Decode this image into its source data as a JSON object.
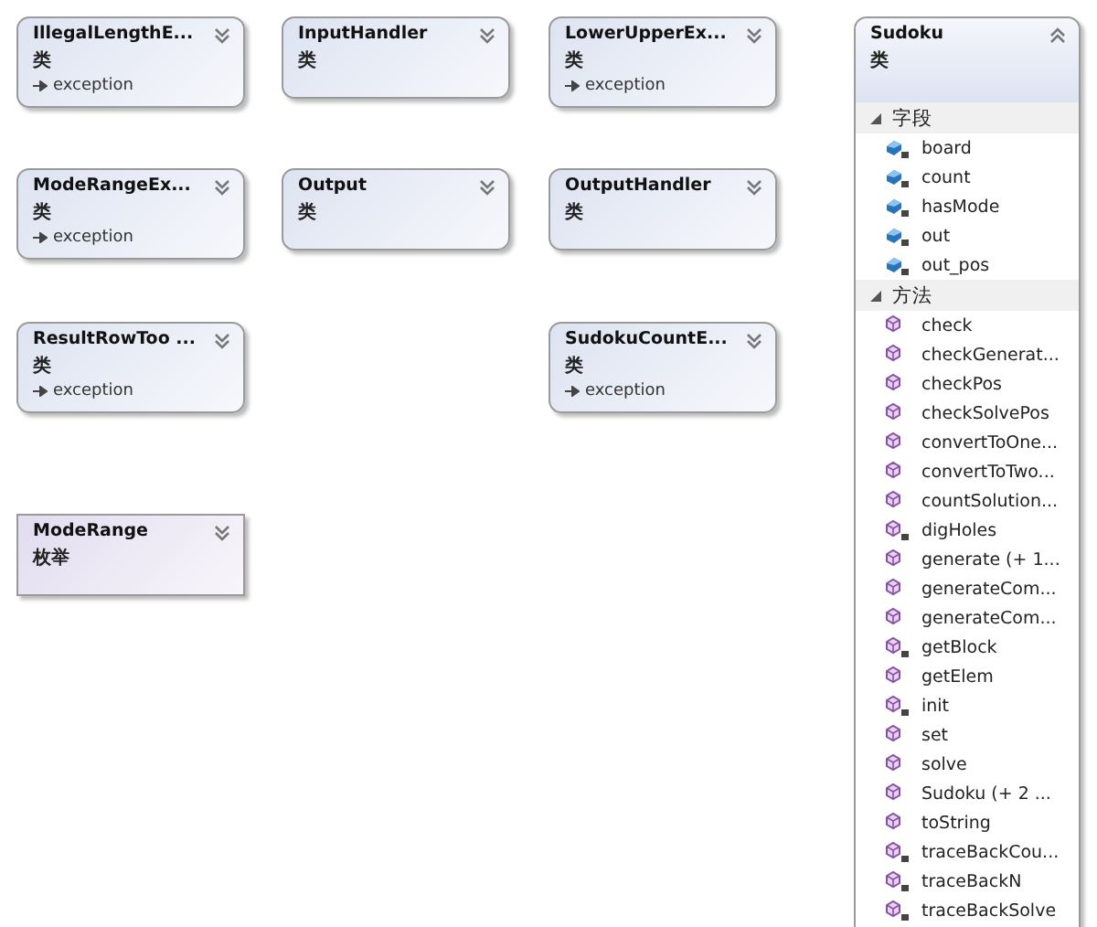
{
  "shapes": [
    {
      "name": "IllegalLengthE...",
      "kind": "class",
      "type_label": "类",
      "base": "exception",
      "expanded": false
    },
    {
      "name": "InputHandler",
      "kind": "class",
      "type_label": "类",
      "expanded": false
    },
    {
      "name": "LowerUpperEx...",
      "kind": "class",
      "type_label": "类",
      "base": "exception",
      "expanded": false
    },
    {
      "name": "ModeRangeEx...",
      "kind": "class",
      "type_label": "类",
      "base": "exception",
      "expanded": false
    },
    {
      "name": "Output",
      "kind": "class",
      "type_label": "类",
      "expanded": false
    },
    {
      "name": "OutputHandler",
      "kind": "class",
      "type_label": "类",
      "expanded": false
    },
    {
      "name": "ResultRowToo ...",
      "kind": "class",
      "type_label": "类",
      "base": "exception",
      "expanded": false
    },
    {
      "name": "SudokuCountE...",
      "kind": "class",
      "type_label": "类",
      "base": "exception",
      "expanded": false
    },
    {
      "name": "ModeRange",
      "kind": "enum",
      "type_label": "枚举",
      "expanded": false
    }
  ],
  "sudoku": {
    "name": "Sudoku",
    "type_label": "类",
    "expanded": true,
    "sections": [
      {
        "title": "字段",
        "kind": "field",
        "expanded": true,
        "members": [
          {
            "name": "board",
            "private": true
          },
          {
            "name": "count",
            "private": true
          },
          {
            "name": "hasMode",
            "private": true
          },
          {
            "name": "out",
            "private": true
          },
          {
            "name": "out_pos",
            "private": true
          }
        ]
      },
      {
        "title": "方法",
        "kind": "method",
        "expanded": true,
        "members": [
          {
            "name": "check",
            "private": false
          },
          {
            "name": "checkGenerat...",
            "private": false
          },
          {
            "name": "checkPos",
            "private": false
          },
          {
            "name": "checkSolvePos",
            "private": false
          },
          {
            "name": "convertToOne...",
            "private": false
          },
          {
            "name": "convertToTwo...",
            "private": false
          },
          {
            "name": "countSolution...",
            "private": false
          },
          {
            "name": "digHoles",
            "private": true
          },
          {
            "name": "generate (+ 1...",
            "private": false
          },
          {
            "name": "generateCom...",
            "private": false
          },
          {
            "name": "generateCom...",
            "private": false
          },
          {
            "name": "getBlock",
            "private": true
          },
          {
            "name": "getElem",
            "private": false
          },
          {
            "name": "init",
            "private": true
          },
          {
            "name": "set",
            "private": false
          },
          {
            "name": "solve",
            "private": false
          },
          {
            "name": "Sudoku (+ 2 ...",
            "private": false
          },
          {
            "name": "toString",
            "private": false
          },
          {
            "name": "traceBackCou...",
            "private": true
          },
          {
            "name": "traceBackN",
            "private": true
          },
          {
            "name": "traceBackSolve",
            "private": true
          }
        ]
      }
    ]
  }
}
